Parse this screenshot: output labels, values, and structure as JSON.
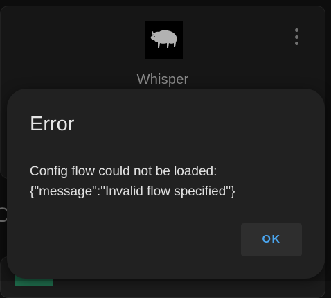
{
  "integration_card": {
    "name": "Whisper",
    "logo_icon": "bison-icon",
    "menu_icon": "more-vertical-icon"
  },
  "background_peek": {
    "letter": "C"
  },
  "dialog": {
    "title": "Error",
    "message_line1": "Config flow could not be loaded:",
    "message_line2": "{\"message\":\"Invalid flow specified\"}",
    "ok_label": "OK"
  },
  "colors": {
    "page_background": "#111111",
    "card_background": "#1c1c1c",
    "dialog_background": "#212121",
    "button_background": "#2e2e2e",
    "accent": "#4aa6f0"
  }
}
